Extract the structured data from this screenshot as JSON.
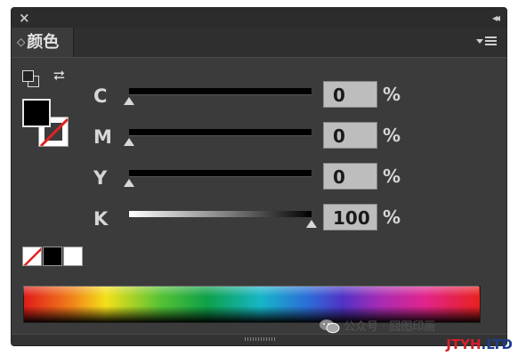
{
  "panel": {
    "tab_label": "颜色",
    "tab_arrows": "◇",
    "close_glyph": "×",
    "collapse_glyph": "◂◂"
  },
  "swatches": {
    "fill_color": "#000000",
    "stroke": "none"
  },
  "sliders": [
    {
      "label": "C",
      "value": "0",
      "unit": "%",
      "level": 0
    },
    {
      "label": "M",
      "value": "0",
      "unit": "%",
      "level": 0
    },
    {
      "label": "Y",
      "value": "0",
      "unit": "%",
      "level": 0
    },
    {
      "label": "K",
      "value": "100",
      "unit": "%",
      "level": 100
    }
  ],
  "mini_swatches": [
    "none",
    "black",
    "white"
  ],
  "watermark": {
    "text": "公众号 · 囧图印画",
    "site_part_a": "JTYH",
    "site_part_b": ".LTD"
  },
  "colors": {
    "panel_bg": "#3b3b3b",
    "titlebar_bg": "#2c2c2c",
    "field_bg": "#bdbdbd",
    "label": "#d6d6d6"
  },
  "icons": {
    "close": "close-icon",
    "collapse": "collapse-double-arrow-icon",
    "panel_menu": "panel-menu-icon",
    "swap": "swap-fill-stroke-icon",
    "default": "default-fill-stroke-icon"
  }
}
